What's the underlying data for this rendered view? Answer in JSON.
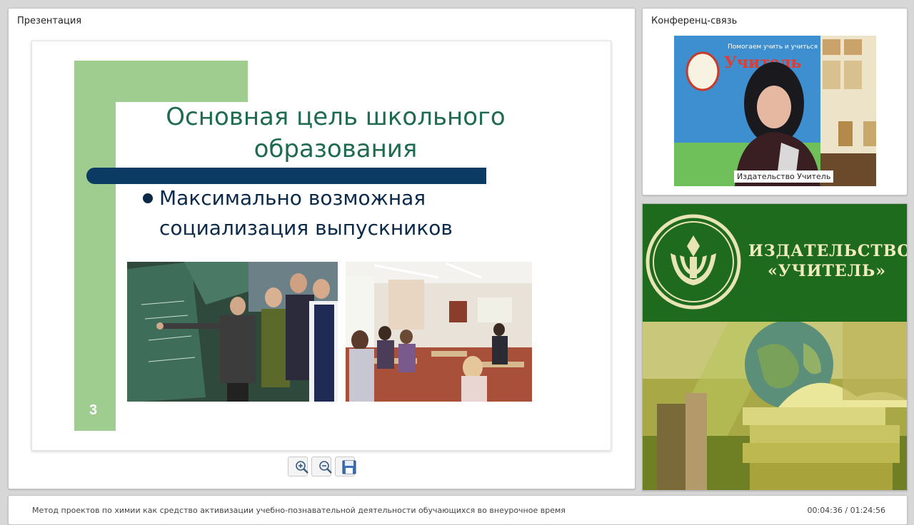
{
  "presentation": {
    "title": "Презентация",
    "slide": {
      "title": "Основная цель школьного образования",
      "bullet": "Максимально возможная социализация выпускников",
      "number": "3"
    }
  },
  "conference": {
    "title": "Конференц-связь",
    "participant_name": "Издательство Учитель",
    "banner_text": "Помогаем учить и учиться",
    "banner_logo": "Учитель"
  },
  "brand": {
    "line1": "ИЗДАТЕЛЬСТВО",
    "line2": "«УЧИТЕЛЬ»"
  },
  "footer": {
    "title": "Метод проектов по химии как средство активизации учебно-познавательной деятельности обучающихся во внеурочное время",
    "time": "00:04:36 / 01:24:56"
  },
  "colors": {
    "slide_green": "#9fcc8f",
    "slide_navy": "#0b3a63",
    "title_green": "#1f6b4f",
    "brand_green": "#1e6b1e"
  },
  "icons": [
    "zoom-in-icon",
    "zoom-out-icon",
    "save-icon"
  ]
}
